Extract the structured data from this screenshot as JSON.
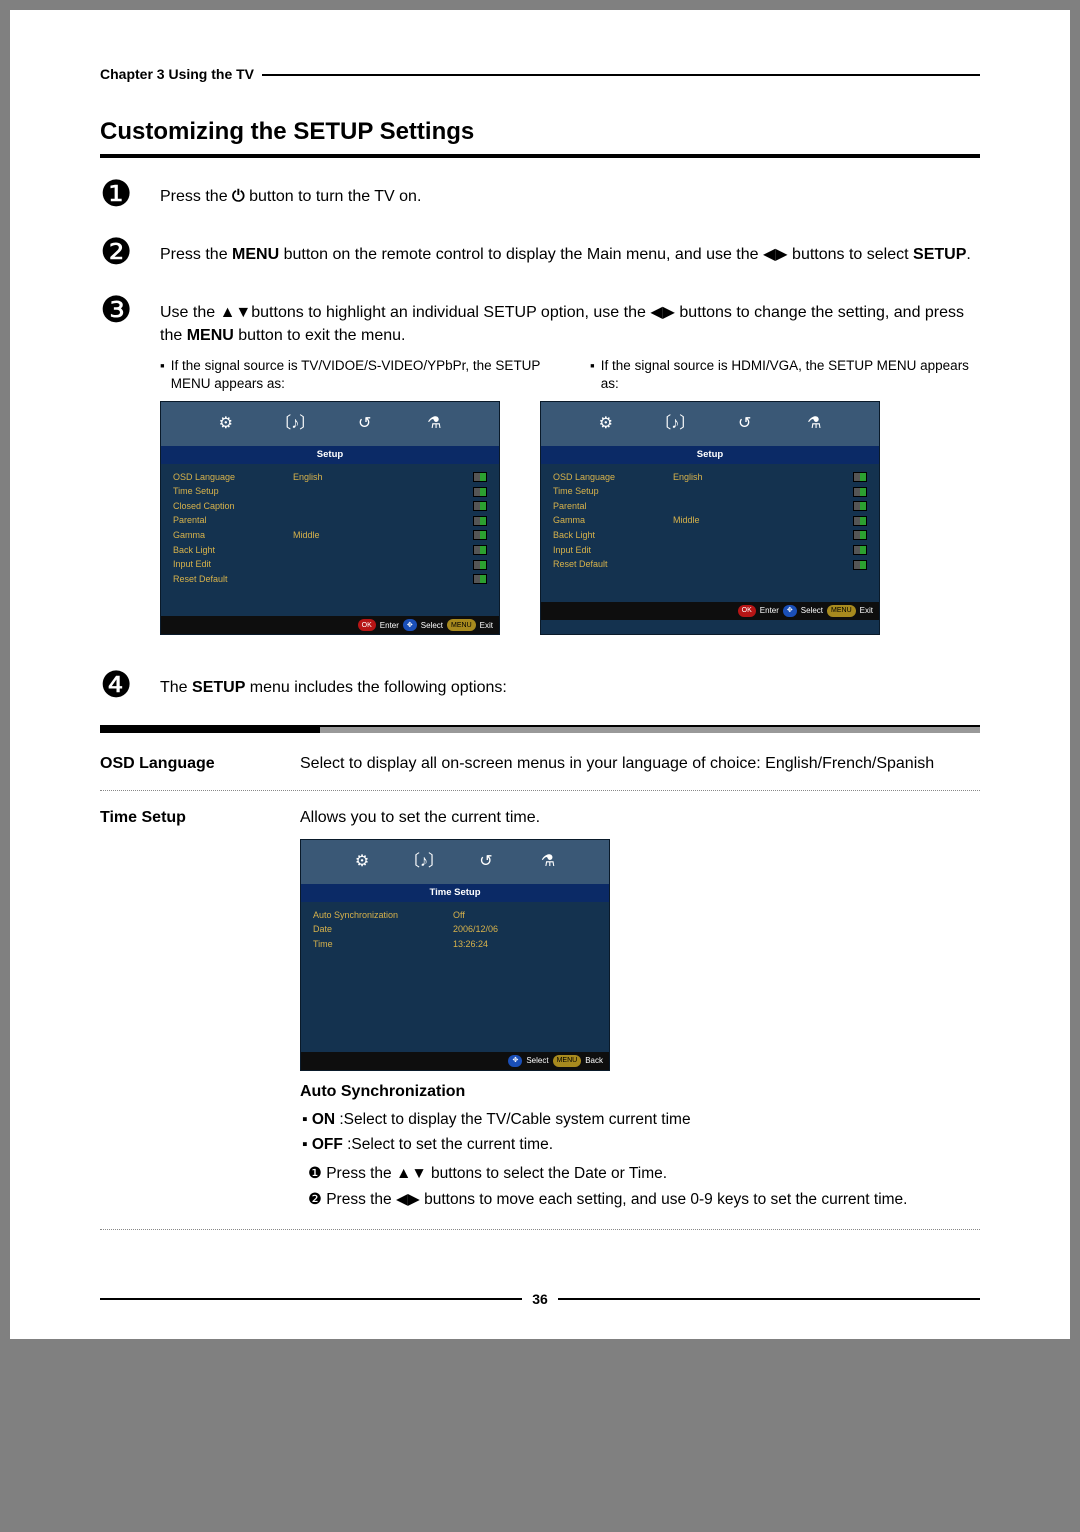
{
  "chapter": "Chapter 3 Using the TV",
  "title": "Customizing the SETUP Settings",
  "steps": {
    "s1": {
      "num": "❶",
      "text_before": "Press the ",
      "icon": "⏻",
      "text_after": " button to turn the TV on."
    },
    "s2": {
      "num": "❷",
      "text": "Press the MENU button on the remote control to display the Main menu, and use the ◀▶ buttons to select SETUP."
    },
    "s3": {
      "num": "❸",
      "text": "Use the   ▲▼buttons to highlight an individual SETUP option, use the ◀▶ buttons to change the setting, and press the MENU button to exit the menu.",
      "note_left": "If the signal source is TV/VIDOE/S-VIDEO/YPbPr, the SETUP MENU appears as:",
      "note_right": "If the signal source is HDMI/VGA, the SETUP MENU appears as:"
    },
    "s4": {
      "num": "❹",
      "text": "The SETUP menu includes the following options:"
    }
  },
  "osd": {
    "tab": "Setup",
    "icons": [
      "⚙",
      "〔♪〕",
      "↺",
      "⚗"
    ],
    "footer": {
      "enter": "Enter",
      "select": "Select",
      "exit": "Exit",
      "back": "Back",
      "menu": "MENU",
      "ok": "OK"
    },
    "menu_a": [
      {
        "lbl": "OSD Language",
        "val": "English"
      },
      {
        "lbl": "Time Setup",
        "val": ""
      },
      {
        "lbl": "Closed Caption",
        "val": ""
      },
      {
        "lbl": "Parental",
        "val": ""
      },
      {
        "lbl": "Gamma",
        "val": "Middle"
      },
      {
        "lbl": "Back Light",
        "val": ""
      },
      {
        "lbl": "Input Edit",
        "val": ""
      },
      {
        "lbl": "Reset Default",
        "val": ""
      }
    ],
    "menu_b": [
      {
        "lbl": "OSD Language",
        "val": "English"
      },
      {
        "lbl": "Time Setup",
        "val": ""
      },
      {
        "lbl": "Parental",
        "val": ""
      },
      {
        "lbl": "Gamma",
        "val": "Middle"
      },
      {
        "lbl": "Back Light",
        "val": ""
      },
      {
        "lbl": "Input Edit",
        "val": ""
      },
      {
        "lbl": "Reset Default",
        "val": ""
      }
    ],
    "time_tab": "Time Setup",
    "time_rows": [
      {
        "lbl": "Auto Synchronization",
        "val": "Off"
      },
      {
        "lbl": "Date",
        "val": "2006/12/06"
      },
      {
        "lbl": "Time",
        "val": "13:26:24"
      }
    ]
  },
  "options": {
    "osd_lang": {
      "name": "OSD Language",
      "desc": "Select to display all on-screen menus in your language of choice: English/French/Spanish"
    },
    "time_setup": {
      "name": "Time Setup",
      "desc": "Allows you to set the current time.",
      "auto_head": "Auto Synchronization",
      "on": "ON :Select to display the TV/Cable system current time",
      "off": "OFF :Select to set the current time.",
      "sub1_pre": "❶ Press the ",
      "sub1_mid": "▲▼",
      "sub1_post": " buttons to select the Date or Time.",
      "sub2_pre": "❷ Press the ",
      "sub2_mid": "◀▶",
      "sub2_post": " buttons to move each setting, and use 0-9 keys to set the current time."
    }
  },
  "page_number": "36"
}
